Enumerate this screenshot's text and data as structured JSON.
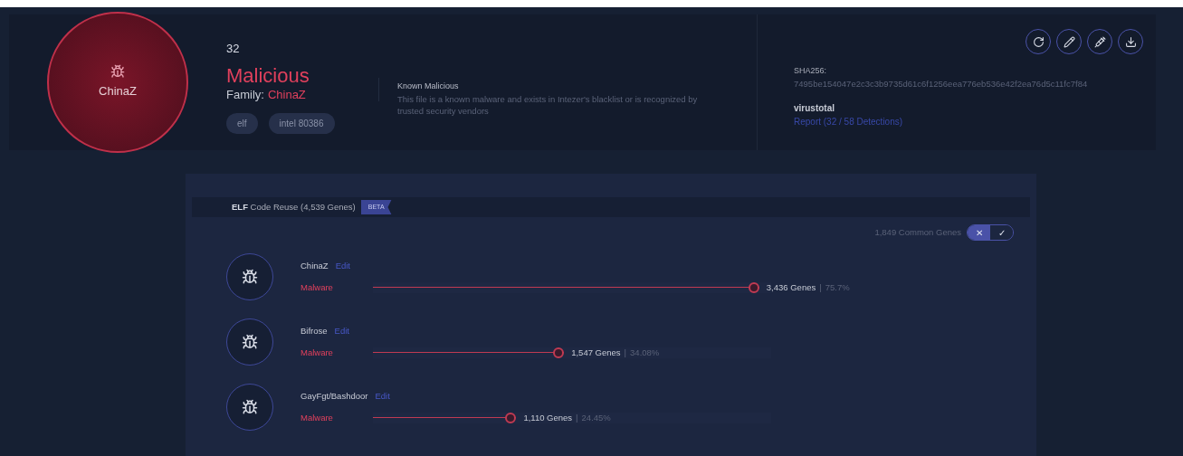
{
  "summary": {
    "circle_label": "ChinaZ",
    "score": "32",
    "verdict": "Malicious",
    "family_label": "Family:",
    "family": "ChinaZ",
    "tags": [
      "elf",
      "intel 80386"
    ],
    "verdict_title": "Known Malicious",
    "verdict_text": "This file is a known malware and exists in Intezer's blacklist or is recognized by trusted security vendors"
  },
  "hash_panel": {
    "sha_label": "SHA256:",
    "sha": "7495be154047e2c3c3b9735d61c6f1256eea776eb536e42f2ea76d5c11fc7f84",
    "vt_label": "virustotal",
    "vt_link": "Report (32 / 58 Detections)"
  },
  "code_reuse": {
    "title_bold": "ELF",
    "title": "Code Reuse (4,539 Genes)",
    "badge": "BETA",
    "common_genes": "1,849 Common Genes",
    "toggle": [
      {
        "label": "✕",
        "selected": true
      },
      {
        "label": "✓",
        "selected": false
      }
    ],
    "families": [
      {
        "name": "ChinaZ",
        "edit": "Edit",
        "type": "Malware",
        "level": 0.97,
        "genes": "3,436 Genes",
        "separator": "|",
        "percent": "75.7%"
      },
      {
        "name": "Bifrose",
        "edit": "Edit",
        "type": "Malware",
        "level": 0.48,
        "genes": "1,547 Genes",
        "separator": "|",
        "percent": "34.08%"
      },
      {
        "name": "GayFgt/Bashdoor",
        "edit": "Edit",
        "type": "Malware",
        "level": 0.36,
        "genes": "1,110 Genes",
        "separator": "|",
        "percent": "24.45%"
      }
    ]
  }
}
